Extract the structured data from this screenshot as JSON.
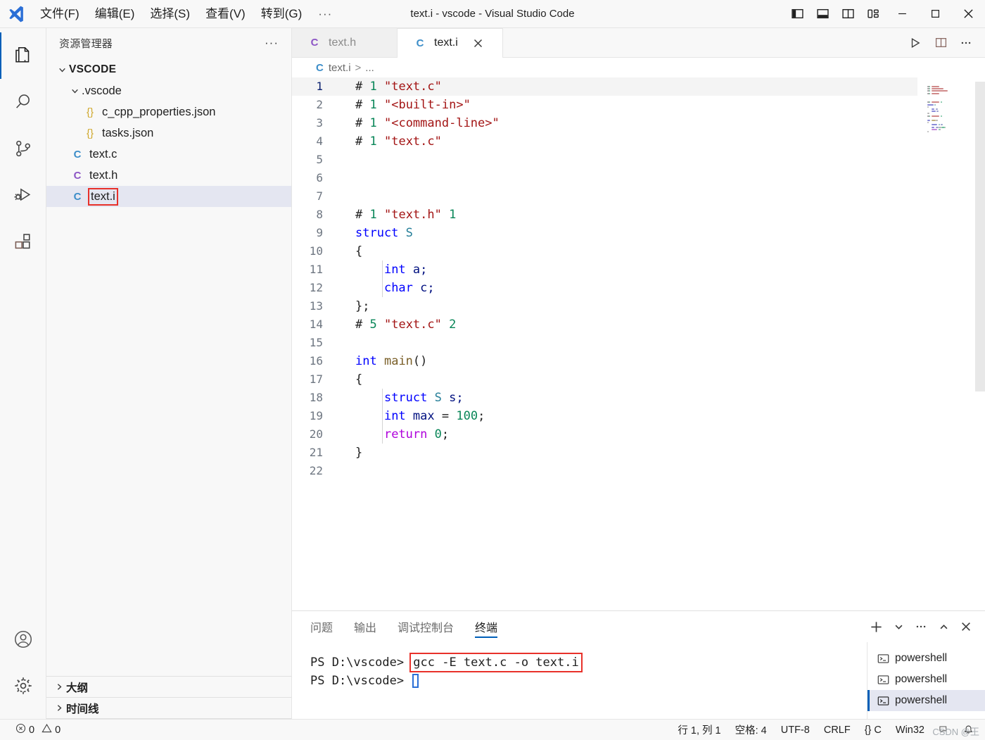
{
  "window": {
    "title": "text.i - vscode - Visual Studio Code",
    "logo_icon": "vscode-logo",
    "menu": [
      {
        "label": "文件(F)",
        "name": "menu-file"
      },
      {
        "label": "编辑(E)",
        "name": "menu-edit"
      },
      {
        "label": "选择(S)",
        "name": "menu-selection"
      },
      {
        "label": "查看(V)",
        "name": "menu-view"
      },
      {
        "label": "转到(G)",
        "name": "menu-go"
      }
    ],
    "menu_overflow": "···",
    "layout_buttons": [
      {
        "name": "toggle-primary-sidebar-icon",
        "title": "切换主侧栏"
      },
      {
        "name": "toggle-panel-icon",
        "title": "切换面板"
      },
      {
        "name": "toggle-secondary-sidebar-icon",
        "title": "切换辅助侧栏"
      },
      {
        "name": "customize-layout-icon",
        "title": "自定义布局"
      }
    ],
    "window_buttons": [
      {
        "name": "minimize-button"
      },
      {
        "name": "maximize-button"
      },
      {
        "name": "close-button"
      }
    ]
  },
  "activity_bar": {
    "items": [
      {
        "name": "activity-explorer",
        "icon": "files-icon",
        "active": true
      },
      {
        "name": "activity-search",
        "icon": "search-icon",
        "active": false
      },
      {
        "name": "activity-source-control",
        "icon": "source-control-icon",
        "active": false
      },
      {
        "name": "activity-run-debug",
        "icon": "run-debug-icon",
        "active": false
      },
      {
        "name": "activity-extensions",
        "icon": "extensions-icon",
        "active": false
      }
    ],
    "bottom": [
      {
        "name": "activity-accounts",
        "icon": "account-icon"
      },
      {
        "name": "activity-settings",
        "icon": "gear-icon"
      }
    ]
  },
  "sidebar": {
    "title": "资源管理器",
    "more_actions": "···",
    "tree": [
      {
        "label": "VSCODE",
        "depth": 0,
        "kind": "folder-root",
        "expanded": true,
        "selected": false
      },
      {
        "label": ".vscode",
        "depth": 1,
        "kind": "folder",
        "expanded": true,
        "selected": false
      },
      {
        "label": "c_cpp_properties.json",
        "depth": 2,
        "kind": "json",
        "icon": "{}",
        "selected": false
      },
      {
        "label": "tasks.json",
        "depth": 2,
        "kind": "json",
        "icon": "{}",
        "selected": false
      },
      {
        "label": "text.c",
        "depth": 1,
        "kind": "c-blue",
        "icon": "C",
        "selected": false
      },
      {
        "label": "text.h",
        "depth": 1,
        "kind": "c-purple",
        "icon": "C",
        "selected": false
      },
      {
        "label": "text.i",
        "depth": 1,
        "kind": "c-blue",
        "icon": "C",
        "selected": true,
        "highlight": true
      }
    ],
    "sections": [
      {
        "label": "大纲",
        "name": "sidebar-section-outline",
        "expanded": false
      },
      {
        "label": "时间线",
        "name": "sidebar-section-timeline",
        "expanded": false
      }
    ]
  },
  "editor": {
    "tabs": [
      {
        "label": "text.h",
        "icon": "C",
        "icon_color": "c-purple",
        "active": false,
        "closable": false
      },
      {
        "label": "text.i",
        "icon": "C",
        "icon_color": "c-blue",
        "active": true,
        "closable": true
      }
    ],
    "tab_close_icon": "close-icon",
    "toolbar": [
      {
        "name": "run-code-button",
        "icon": "play-icon"
      },
      {
        "name": "split-editor-button",
        "icon": "split-editor-icon"
      },
      {
        "name": "more-actions-button",
        "icon": "ellipsis-icon"
      }
    ],
    "breadcrumb": {
      "icon": "C",
      "file": "text.i",
      "separator": ">",
      "trailing": "..."
    },
    "lines": [
      {
        "n": 1,
        "current": true,
        "tokens": [
          {
            "t": "# ",
            "c": "t-hash"
          },
          {
            "t": "1",
            "c": "t-num"
          },
          {
            "t": " ",
            "c": "t-pl"
          },
          {
            "t": "\"text.c\"",
            "c": "t-str"
          }
        ]
      },
      {
        "n": 2,
        "current": false,
        "tokens": [
          {
            "t": "# ",
            "c": "t-hash"
          },
          {
            "t": "1",
            "c": "t-num"
          },
          {
            "t": " ",
            "c": "t-pl"
          },
          {
            "t": "\"<built-in>\"",
            "c": "t-str"
          }
        ]
      },
      {
        "n": 3,
        "current": false,
        "tokens": [
          {
            "t": "# ",
            "c": "t-hash"
          },
          {
            "t": "1",
            "c": "t-num"
          },
          {
            "t": " ",
            "c": "t-pl"
          },
          {
            "t": "\"<command-line>\"",
            "c": "t-str"
          }
        ]
      },
      {
        "n": 4,
        "current": false,
        "tokens": [
          {
            "t": "# ",
            "c": "t-hash"
          },
          {
            "t": "1",
            "c": "t-num"
          },
          {
            "t": " ",
            "c": "t-pl"
          },
          {
            "t": "\"text.c\"",
            "c": "t-str"
          }
        ]
      },
      {
        "n": 5,
        "current": false,
        "tokens": []
      },
      {
        "n": 6,
        "current": false,
        "tokens": []
      },
      {
        "n": 7,
        "current": false,
        "tokens": []
      },
      {
        "n": 8,
        "current": false,
        "tokens": [
          {
            "t": "# ",
            "c": "t-hash"
          },
          {
            "t": "1",
            "c": "t-num"
          },
          {
            "t": " ",
            "c": "t-pl"
          },
          {
            "t": "\"text.h\"",
            "c": "t-str"
          },
          {
            "t": " ",
            "c": "t-pl"
          },
          {
            "t": "1",
            "c": "t-num"
          }
        ]
      },
      {
        "n": 9,
        "current": false,
        "tokens": [
          {
            "t": "struct",
            "c": "t-kw"
          },
          {
            "t": " ",
            "c": "t-pl"
          },
          {
            "t": "S",
            "c": "t-type"
          }
        ]
      },
      {
        "n": 10,
        "current": false,
        "tokens": [
          {
            "t": "{",
            "c": "t-pl"
          }
        ]
      },
      {
        "n": 11,
        "current": false,
        "indent": true,
        "tokens": [
          {
            "t": "    ",
            "c": "t-pl"
          },
          {
            "t": "int",
            "c": "t-kw"
          },
          {
            "t": " ",
            "c": "t-pl"
          },
          {
            "t": "a;",
            "c": "t-var"
          }
        ]
      },
      {
        "n": 12,
        "current": false,
        "indent": true,
        "tokens": [
          {
            "t": "    ",
            "c": "t-pl"
          },
          {
            "t": "char",
            "c": "t-kw"
          },
          {
            "t": " ",
            "c": "t-pl"
          },
          {
            "t": "c;",
            "c": "t-var"
          }
        ]
      },
      {
        "n": 13,
        "current": false,
        "tokens": [
          {
            "t": "};",
            "c": "t-pl"
          }
        ]
      },
      {
        "n": 14,
        "current": false,
        "tokens": [
          {
            "t": "# ",
            "c": "t-hash"
          },
          {
            "t": "5",
            "c": "t-num"
          },
          {
            "t": " ",
            "c": "t-pl"
          },
          {
            "t": "\"text.c\"",
            "c": "t-str"
          },
          {
            "t": " ",
            "c": "t-pl"
          },
          {
            "t": "2",
            "c": "t-num"
          }
        ]
      },
      {
        "n": 15,
        "current": false,
        "tokens": []
      },
      {
        "n": 16,
        "current": false,
        "tokens": [
          {
            "t": "int",
            "c": "t-kw"
          },
          {
            "t": " ",
            "c": "t-pl"
          },
          {
            "t": "main",
            "c": "t-fn"
          },
          {
            "t": "()",
            "c": "t-pl"
          }
        ]
      },
      {
        "n": 17,
        "current": false,
        "tokens": [
          {
            "t": "{",
            "c": "t-pl"
          }
        ]
      },
      {
        "n": 18,
        "current": false,
        "indent": true,
        "tokens": [
          {
            "t": "    ",
            "c": "t-pl"
          },
          {
            "t": "struct",
            "c": "t-kw"
          },
          {
            "t": " ",
            "c": "t-pl"
          },
          {
            "t": "S",
            "c": "t-type"
          },
          {
            "t": " ",
            "c": "t-pl"
          },
          {
            "t": "s;",
            "c": "t-var"
          }
        ]
      },
      {
        "n": 19,
        "current": false,
        "indent": true,
        "tokens": [
          {
            "t": "    ",
            "c": "t-pl"
          },
          {
            "t": "int",
            "c": "t-kw"
          },
          {
            "t": " ",
            "c": "t-pl"
          },
          {
            "t": "max",
            "c": "t-var"
          },
          {
            "t": " = ",
            "c": "t-pl"
          },
          {
            "t": "100",
            "c": "t-num"
          },
          {
            "t": ";",
            "c": "t-pl"
          }
        ]
      },
      {
        "n": 20,
        "current": false,
        "indent": true,
        "tokens": [
          {
            "t": "    ",
            "c": "t-pl"
          },
          {
            "t": "return",
            "c": "t-ctl"
          },
          {
            "t": " ",
            "c": "t-pl"
          },
          {
            "t": "0",
            "c": "t-num"
          },
          {
            "t": ";",
            "c": "t-pl"
          }
        ]
      },
      {
        "n": 21,
        "current": false,
        "tokens": [
          {
            "t": "}",
            "c": "t-pl"
          }
        ]
      },
      {
        "n": 22,
        "current": false,
        "tokens": []
      }
    ]
  },
  "panel": {
    "tabs": [
      {
        "label": "问题",
        "name": "panel-tab-problems",
        "active": false
      },
      {
        "label": "输出",
        "name": "panel-tab-output",
        "active": false
      },
      {
        "label": "调试控制台",
        "name": "panel-tab-debug-console",
        "active": false
      },
      {
        "label": "终端",
        "name": "panel-tab-terminal",
        "active": true
      }
    ],
    "actions": [
      {
        "name": "new-terminal-button",
        "icon": "plus-icon"
      },
      {
        "name": "terminal-profile-dropdown",
        "icon": "chevron-down-icon"
      },
      {
        "name": "panel-more-actions-button",
        "icon": "ellipsis-icon"
      },
      {
        "name": "maximize-panel-button",
        "icon": "chevron-up-icon"
      },
      {
        "name": "close-panel-button",
        "icon": "close-icon"
      }
    ],
    "terminal": {
      "lines": [
        {
          "prompt": "PS D:\\vscode> ",
          "command": "gcc -E text.c -o text.i",
          "highlight": true,
          "cursor": false
        },
        {
          "prompt": "PS D:\\vscode> ",
          "command": "",
          "highlight": false,
          "cursor": true
        }
      ]
    },
    "terminal_list": [
      {
        "label": "powershell",
        "icon": "terminal-icon",
        "selected": false
      },
      {
        "label": "powershell",
        "icon": "terminal-icon",
        "selected": false
      },
      {
        "label": "powershell",
        "icon": "terminal-icon",
        "selected": true
      }
    ]
  },
  "status_bar": {
    "errors_icon": "error-icon",
    "errors": "0",
    "warnings_icon": "warning-icon",
    "warnings": "0",
    "cursor_position": "行 1, 列 1",
    "indentation": "空格: 4",
    "encoding": "UTF-8",
    "eol": "CRLF",
    "language_icon": "{}",
    "language": "C",
    "platform": "Win32",
    "notification_icon": "bell-icon",
    "feedback_icon": "feedback-icon",
    "watermark": "CSDN @王"
  },
  "colors": {
    "accent": "#005fb8",
    "annotation_red": "#e8312a",
    "selection": "#e4e6f1",
    "titlebar_bg": "#f8f8f8",
    "editor_bg": "#ffffff"
  }
}
